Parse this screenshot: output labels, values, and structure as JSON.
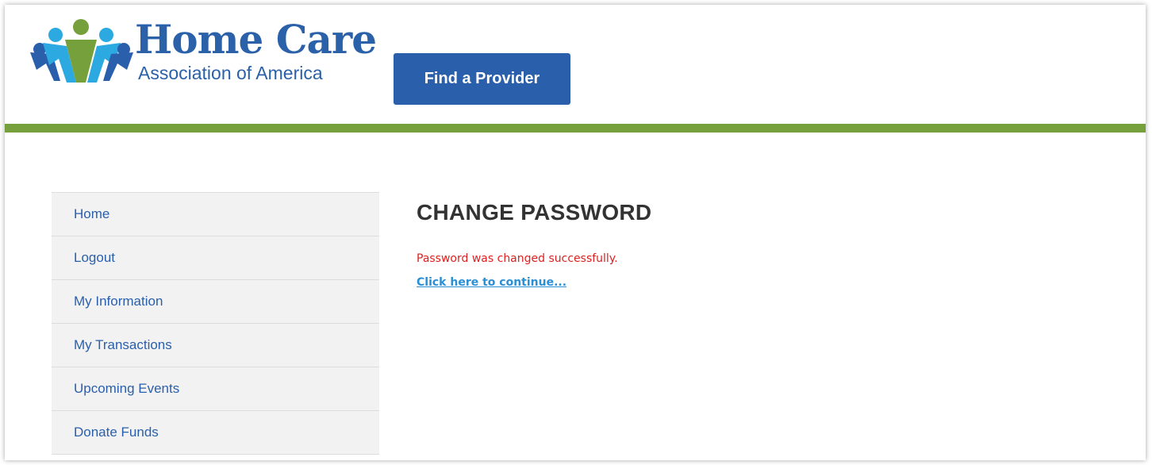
{
  "header": {
    "logo": {
      "title": "Home Care",
      "subtitle": "Association of America"
    },
    "find_provider_label": "Find a Provider"
  },
  "colors": {
    "brand_blue": "#2a5fab",
    "accent_green": "#76a03c",
    "logo_light_blue": "#2ca9e0",
    "success_red": "#e02020",
    "link_blue": "#2b8fd6"
  },
  "sidebar": {
    "items": [
      {
        "label": "Home"
      },
      {
        "label": "Logout"
      },
      {
        "label": "My Information"
      },
      {
        "label": "My Transactions"
      },
      {
        "label": "Upcoming Events"
      },
      {
        "label": "Donate Funds"
      }
    ]
  },
  "main": {
    "title": "CHANGE PASSWORD",
    "success_message": "Password was changed successfully.",
    "continue_link": "Click here to continue..."
  }
}
